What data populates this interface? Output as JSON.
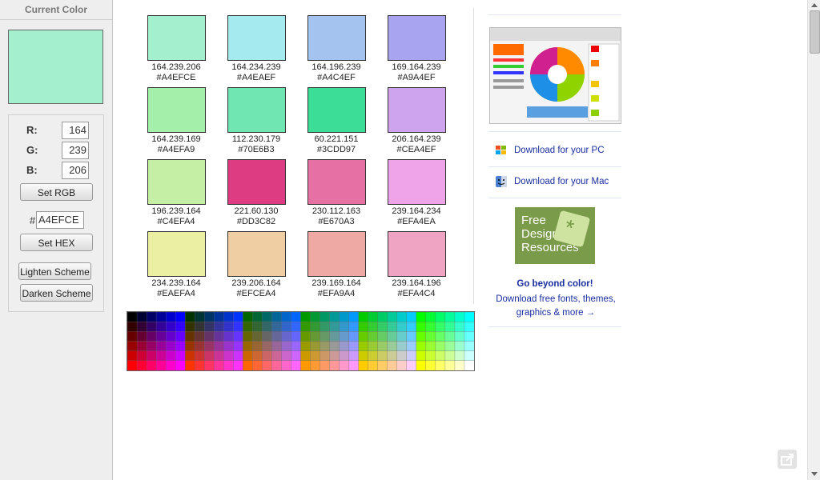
{
  "left": {
    "title": "Current Color",
    "current_hex": "#A4EFCE",
    "r_label": "R:",
    "r_value": "164",
    "g_label": "G:",
    "g_value": "239",
    "b_label": "B:",
    "b_value": "206",
    "set_rgb": "Set RGB",
    "hash": "#",
    "hex_value": "A4EFCE",
    "set_hex": "Set HEX",
    "lighten": "Lighten Scheme",
    "darken": "Darken Scheme"
  },
  "swatches": [
    {
      "rgb": "164.239.206",
      "hex": "#A4EFCE"
    },
    {
      "rgb": "164.234.239",
      "hex": "#A4EAEF"
    },
    {
      "rgb": "164.196.239",
      "hex": "#A4C4EF"
    },
    {
      "rgb": "169.164.239",
      "hex": "#A9A4EF"
    },
    {
      "rgb": "164.239.169",
      "hex": "#A4EFA9"
    },
    {
      "rgb": "112.230.179",
      "hex": "#70E6B3"
    },
    {
      "rgb": "60.221.151",
      "hex": "#3CDD97"
    },
    {
      "rgb": "206.164.239",
      "hex": "#CEA4EF"
    },
    {
      "rgb": "196.239.164",
      "hex": "#C4EFA4"
    },
    {
      "rgb": "221.60.130",
      "hex": "#DD3C82"
    },
    {
      "rgb": "230.112.163",
      "hex": "#E670A3"
    },
    {
      "rgb": "239.164.234",
      "hex": "#EFA4EA"
    },
    {
      "rgb": "234.239.164",
      "hex": "#EAEFA4"
    },
    {
      "rgb": "239.206.164",
      "hex": "#EFCEA4"
    },
    {
      "rgb": "239.169.164",
      "hex": "#EFA9A4"
    },
    {
      "rgb": "239.164.196",
      "hex": "#EFA4C4"
    }
  ],
  "right": {
    "download_pc": "Download for your PC",
    "download_mac": "Download for your Mac",
    "ad_text_1": "Free",
    "ad_text_2": "Design",
    "ad_text_3": "Resources",
    "promo_heading": "Go beyond color!",
    "promo_line1": "Download free fonts, themes,",
    "promo_line2": "graphics & more →"
  },
  "icons": {
    "windows": "windows-logo-icon",
    "mac": "mac-finder-icon",
    "share": "share-icon"
  }
}
